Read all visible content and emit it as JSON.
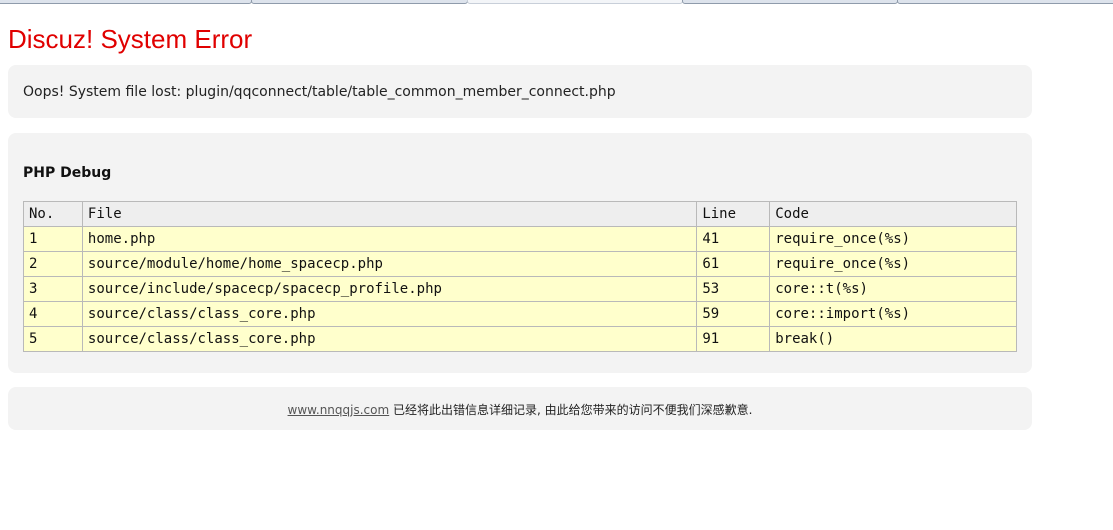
{
  "page": {
    "title": "Discuz! System Error"
  },
  "error": {
    "message": "Oops! System file lost: plugin/qqconnect/table/table_common_member_connect.php"
  },
  "debug": {
    "heading": "PHP Debug",
    "columns": [
      "No.",
      "File",
      "Line",
      "Code"
    ],
    "rows": [
      {
        "no": "1",
        "file": "home.php",
        "line": "41",
        "code": "require_once(%s)"
      },
      {
        "no": "2",
        "file": "source/module/home/home_spacecp.php",
        "line": "61",
        "code": "require_once(%s)"
      },
      {
        "no": "3",
        "file": "source/include/spacecp/spacecp_profile.php",
        "line": "53",
        "code": "core::t(%s)"
      },
      {
        "no": "4",
        "file": "source/class/class_core.php",
        "line": "59",
        "code": "core::import(%s)"
      },
      {
        "no": "5",
        "file": "source/class/class_core.php",
        "line": "91",
        "code": "break()"
      }
    ]
  },
  "footer": {
    "link_text": "www.nnqqjs.com",
    "message": " 已经将此出错信息详细记录, 由此给您带来的访问不便我们深感歉意."
  },
  "colors": {
    "title": "#e00000",
    "box_background": "#f3f3f3",
    "row_background": "#ffffcc",
    "header_background": "#eeeeee"
  }
}
